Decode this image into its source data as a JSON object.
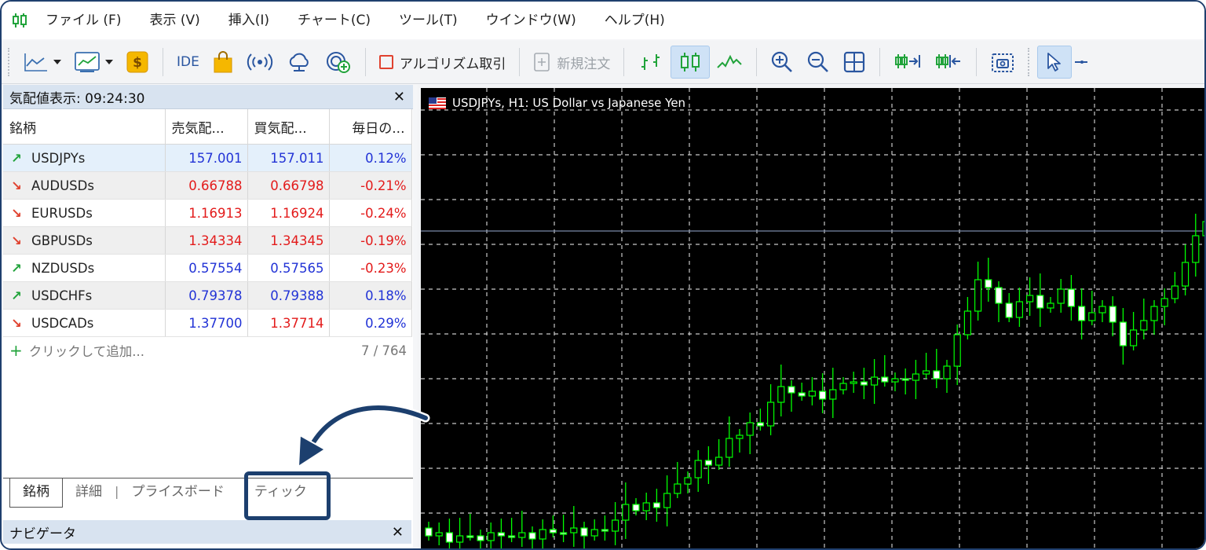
{
  "menu": {
    "items": [
      "ファイル (F)",
      "表示 (V)",
      "挿入(I)",
      "チャート(C)",
      "ツール(T)",
      "ウインドウ(W)",
      "ヘルプ(H)"
    ]
  },
  "toolbar": {
    "ide_label": "IDE",
    "algo_label": "アルゴリズム取引",
    "new_order_label": "新規注文"
  },
  "market_watch": {
    "title": "気配値表示: 09:24:30",
    "columns": [
      "銘柄",
      "売気配...",
      "買気配...",
      "毎日の..."
    ],
    "rows": [
      {
        "symbol": "USDJPYs",
        "dir": "up",
        "bid": "157.001",
        "ask": "157.011",
        "daily": "0.12%"
      },
      {
        "symbol": "AUDUSDs",
        "dir": "down",
        "bid": "0.66788",
        "ask": "0.66798",
        "daily": "-0.21%"
      },
      {
        "symbol": "EURUSDs",
        "dir": "down",
        "bid": "1.16913",
        "ask": "1.16924",
        "daily": "-0.24%"
      },
      {
        "symbol": "GBPUSDs",
        "dir": "down",
        "bid": "1.34334",
        "ask": "1.34345",
        "daily": "-0.19%"
      },
      {
        "symbol": "NZDUSDs",
        "dir": "up",
        "bid": "0.57554",
        "ask": "0.57565",
        "daily": "-0.23%"
      },
      {
        "symbol": "USDCHFs",
        "dir": "up",
        "bid": "0.79378",
        "ask": "0.79388",
        "daily": "0.18%"
      },
      {
        "symbol": "USDCADs",
        "dir": "down",
        "bid": "1.37700",
        "ask": "1.37714",
        "daily": "0.29%"
      }
    ],
    "add_label": "クリックして追加...",
    "count": "7 / 764",
    "tabs": [
      "銘柄",
      "詳細",
      "プライスボード",
      "ティック"
    ]
  },
  "navigator": {
    "title": "ナビゲータ"
  },
  "chart": {
    "title": "USDJPYs, H1:  US Dollar vs Japanese Yen",
    "colors": {
      "background": "#000000",
      "candle": "#00ff00",
      "bull_body": "#000000",
      "bear_body": "#ffffff",
      "grid": "#c8c8c8",
      "price_line": "#7a8aa8"
    }
  },
  "colors": {
    "accent": "#1c3f6e",
    "up": "#21a33b",
    "down": "#e0422f",
    "bid_up": "#2233d6",
    "bid_down": "#e31b1b"
  }
}
